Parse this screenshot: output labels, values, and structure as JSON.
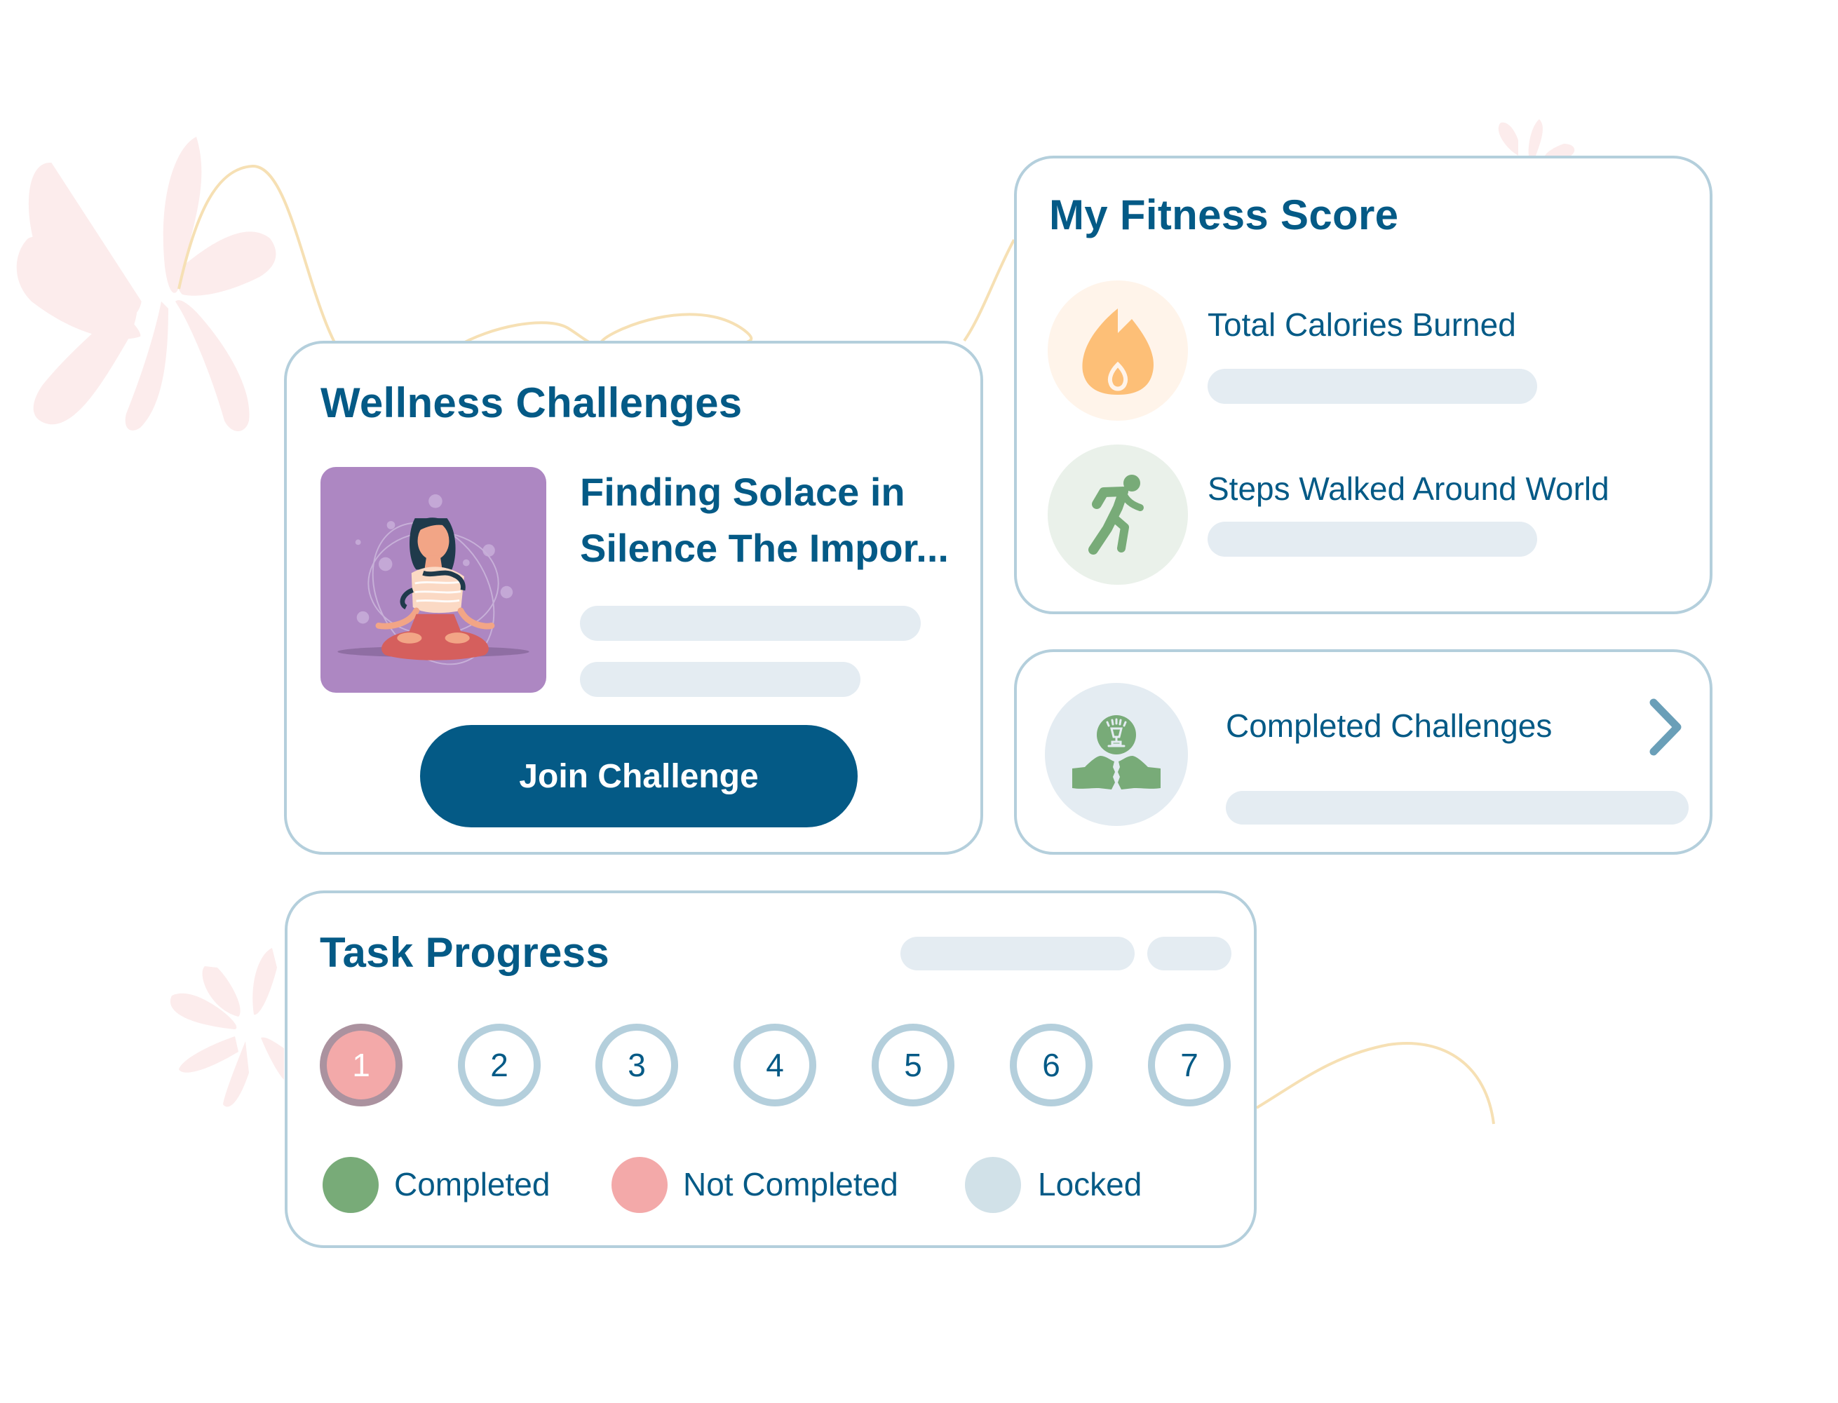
{
  "wellness": {
    "title": "Wellness Challenges",
    "challenge_title": "Finding Solace in Silence The Impor...",
    "thumbnail_icon": "meditation-illustration",
    "join_button": "Join Challenge"
  },
  "fitness": {
    "title": "My Fitness Score",
    "items": [
      {
        "label": "Total Calories Burned",
        "icon": "flame-icon"
      },
      {
        "label": "Steps Walked Around World",
        "icon": "walking-person-icon"
      }
    ]
  },
  "completed": {
    "label": "Completed Challenges",
    "icon": "trophy-fist-bump-icon",
    "chevron": "chevron-right-icon"
  },
  "task": {
    "title": "Task Progress",
    "steps": [
      {
        "number": "1",
        "status": "not_completed",
        "current": true
      },
      {
        "number": "2",
        "status": "locked"
      },
      {
        "number": "3",
        "status": "locked"
      },
      {
        "number": "4",
        "status": "locked"
      },
      {
        "number": "5",
        "status": "locked"
      },
      {
        "number": "6",
        "status": "locked"
      },
      {
        "number": "7",
        "status": "locked"
      }
    ],
    "legend": [
      {
        "label": "Completed",
        "color": "#78ab78"
      },
      {
        "label": "Not Completed",
        "color": "#f3a9a9"
      },
      {
        "label": "Locked",
        "color": "#d1e1e8"
      }
    ]
  },
  "colors": {
    "primary": "#045a86",
    "card_border": "#b4cfdc",
    "placeholder": "#e4ecf2",
    "flame": "#fdbf77",
    "green": "#78ab78",
    "decor_flower": "#fcecec",
    "decor_line": "#f6e0b4"
  }
}
